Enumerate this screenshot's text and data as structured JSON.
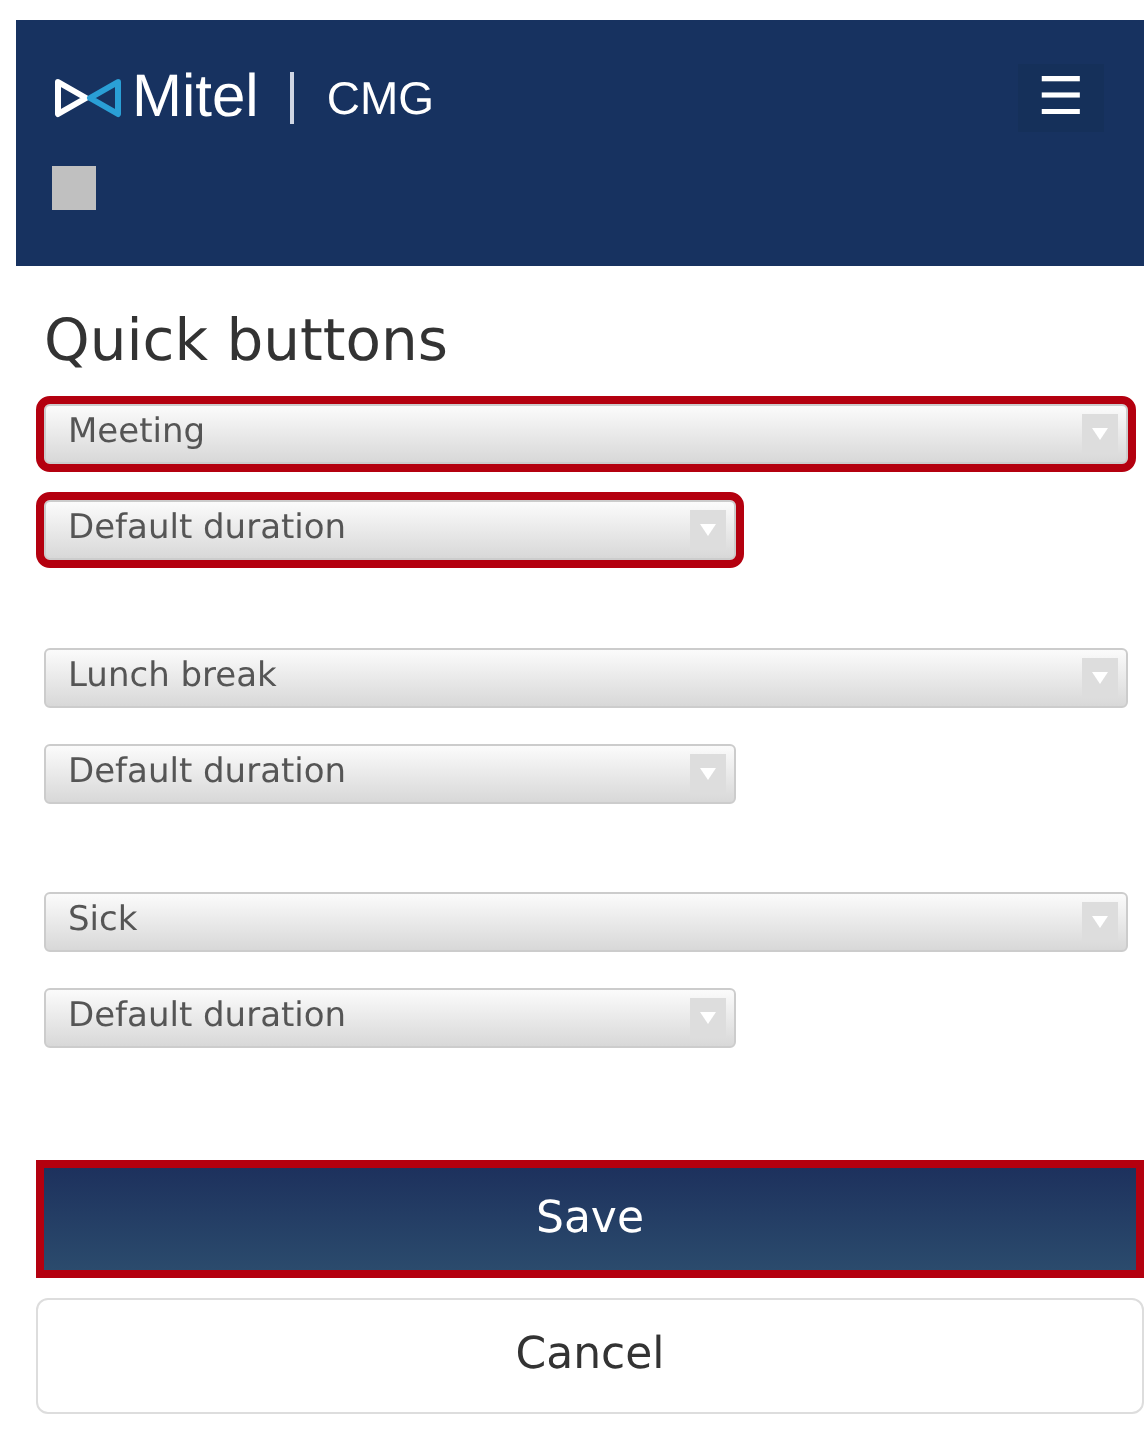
{
  "header": {
    "brand": "Mitel",
    "product": "CMG",
    "menu_icon": "☰"
  },
  "title": "Quick buttons",
  "groups": [
    {
      "status": {
        "value": "Meeting",
        "highlighted": true
      },
      "duration": {
        "value": "Default duration",
        "highlighted": true
      }
    },
    {
      "status": {
        "value": "Lunch break",
        "highlighted": false
      },
      "duration": {
        "value": "Default duration",
        "highlighted": false
      }
    },
    {
      "status": {
        "value": "Sick",
        "highlighted": false
      },
      "duration": {
        "value": "Default duration",
        "highlighted": false
      }
    }
  ],
  "buttons": [
    {
      "kind": "primary",
      "label": "Save",
      "highlighted": true
    },
    {
      "kind": "secondary",
      "label": "Cancel",
      "highlighted": false
    }
  ]
}
